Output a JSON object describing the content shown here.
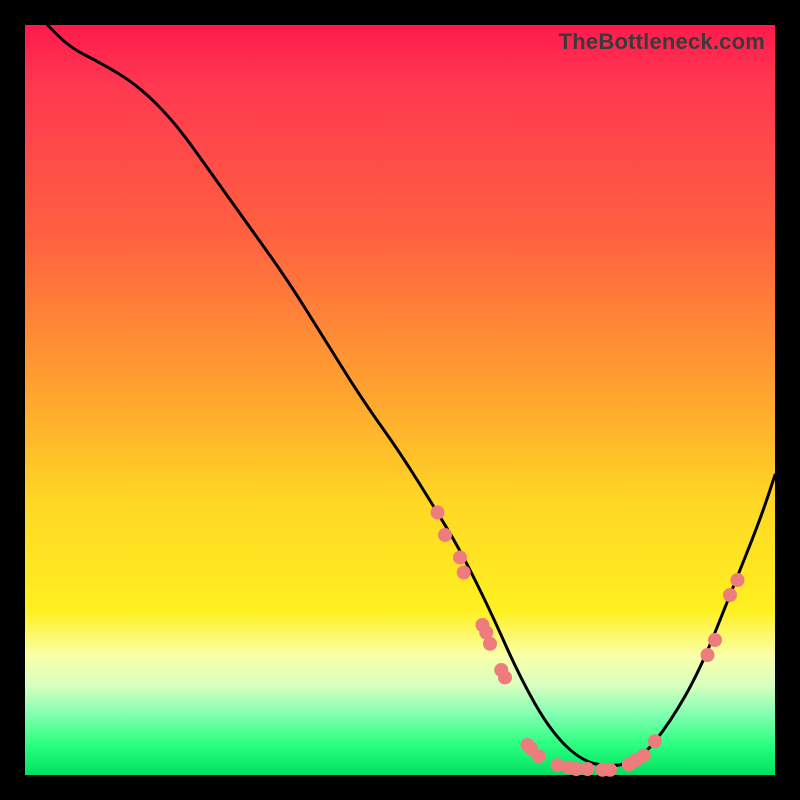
{
  "watermark": "TheBottleneck.com",
  "colors": {
    "background": "#000000",
    "dot": "#ef7c7c",
    "curve": "#000000"
  },
  "chart_data": {
    "type": "line",
    "title": "",
    "xlabel": "",
    "ylabel": "",
    "xlim": [
      0,
      100
    ],
    "ylim": [
      0,
      100
    ],
    "curve": {
      "x": [
        3,
        6,
        10,
        15,
        20,
        25,
        30,
        35,
        40,
        45,
        50,
        55,
        58,
        62,
        66,
        70,
        74,
        78,
        82,
        86,
        90,
        94,
        98,
        100
      ],
      "y": [
        100,
        97,
        95,
        92,
        87,
        80,
        73,
        66,
        58,
        50,
        43,
        35,
        30,
        22,
        13,
        6,
        2,
        1,
        2,
        7,
        14,
        24,
        34,
        40
      ]
    },
    "points": [
      {
        "x": 55,
        "y": 35
      },
      {
        "x": 56,
        "y": 32
      },
      {
        "x": 58,
        "y": 29
      },
      {
        "x": 58.5,
        "y": 27
      },
      {
        "x": 61,
        "y": 20
      },
      {
        "x": 61.5,
        "y": 19
      },
      {
        "x": 62,
        "y": 17.5
      },
      {
        "x": 63.5,
        "y": 14
      },
      {
        "x": 64,
        "y": 13
      },
      {
        "x": 67,
        "y": 4
      },
      {
        "x": 67.5,
        "y": 3.5
      },
      {
        "x": 68.5,
        "y": 2.5
      },
      {
        "x": 71,
        "y": 1.3
      },
      {
        "x": 72.5,
        "y": 1
      },
      {
        "x": 73.5,
        "y": 0.8
      },
      {
        "x": 75,
        "y": 0.8
      },
      {
        "x": 77,
        "y": 0.7
      },
      {
        "x": 78,
        "y": 0.7
      },
      {
        "x": 80.5,
        "y": 1.4
      },
      {
        "x": 81.5,
        "y": 2
      },
      {
        "x": 82.5,
        "y": 2.6
      },
      {
        "x": 84,
        "y": 4.5
      },
      {
        "x": 91,
        "y": 16
      },
      {
        "x": 92,
        "y": 18
      },
      {
        "x": 94,
        "y": 24
      },
      {
        "x": 95,
        "y": 26
      }
    ]
  }
}
